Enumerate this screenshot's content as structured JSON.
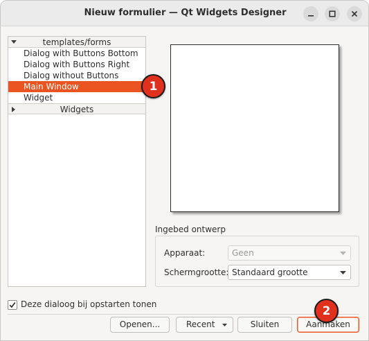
{
  "window": {
    "title": "Nieuw formulier — Qt Widgets Designer",
    "controls": [
      "minimize-icon",
      "maximize-icon",
      "close-icon"
    ]
  },
  "tree": {
    "groups": [
      {
        "label": "templates/forms",
        "expanded": true,
        "items": [
          {
            "label": "Dialog with Buttons Bottom",
            "selected": false
          },
          {
            "label": "Dialog with Buttons Right",
            "selected": false
          },
          {
            "label": "Dialog without Buttons",
            "selected": false
          },
          {
            "label": "Main Window",
            "selected": true
          },
          {
            "label": "Widget",
            "selected": false
          }
        ]
      },
      {
        "label": "Widgets",
        "expanded": false,
        "items": []
      }
    ]
  },
  "embedded": {
    "title": "Ingebed ontwerp",
    "device_label": "Apparaat:",
    "device_value": "Geen",
    "screen_label": "Schermgrootte:",
    "screen_value": "Standaard grootte"
  },
  "startup": {
    "label": "Deze dialoog bij opstarten tonen",
    "checked": true
  },
  "buttons": {
    "open": "Openen...",
    "recent": "Recent",
    "close": "Sluiten",
    "create": "Aanmaken"
  },
  "annotations": {
    "badge1": "1",
    "badge2": "2"
  },
  "colors": {
    "accent": "#e95420",
    "badge": "#e0301e"
  }
}
